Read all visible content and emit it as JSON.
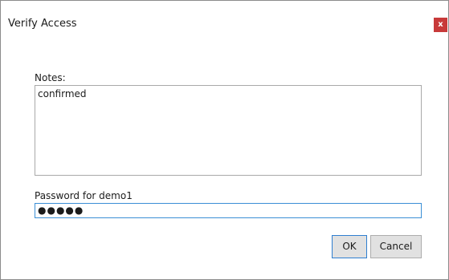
{
  "dialog": {
    "title": "Verify Access",
    "close_label": "x"
  },
  "notes": {
    "label": "Notes:",
    "value": "confirmed"
  },
  "password": {
    "label": "Password for demo1",
    "masked_value": "●●●●●"
  },
  "buttons": {
    "ok_label": "OK",
    "cancel_label": "Cancel"
  },
  "colors": {
    "close_button": "#c83a3a",
    "focus_border": "#3b8fd6"
  }
}
